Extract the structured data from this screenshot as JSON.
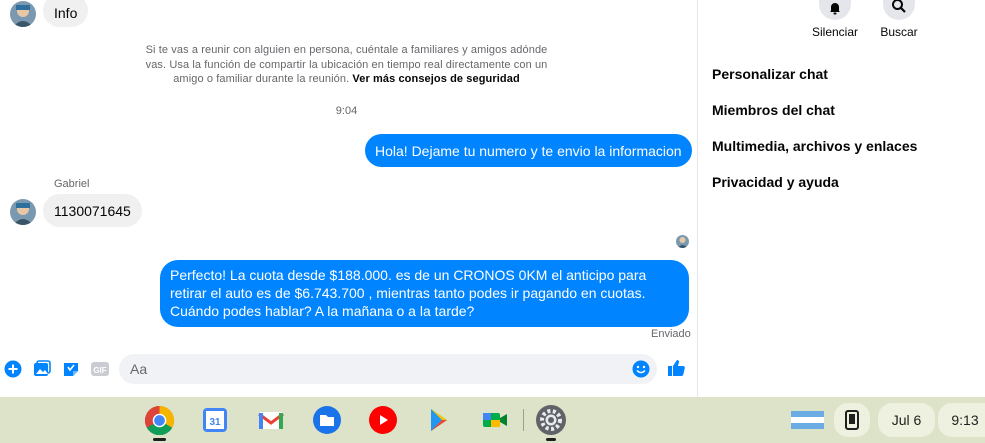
{
  "chat": {
    "top_message": "Info",
    "safety_notice": "Si te vas a reunir con alguien en persona, cuéntale a familiares y amigos adónde vas. Usa la función de compartir la ubicación en tiempo real directamente con un amigo o familiar durante la reunión.",
    "safety_link": "Ver más consejos de seguridad",
    "timestamp": "9:04",
    "sender_name": "Gabriel",
    "messages": [
      {
        "from": "me",
        "text": "Hola! Dejame tu numero y te envio la informacion"
      },
      {
        "from": "them",
        "text": "1130071645"
      },
      {
        "from": "me",
        "text": "Perfecto! La cuota desde $188.000. es de un CRONOS 0KM el anticipo para retirar el auto es de $6.743.700 , mientras tanto podes ir pagando en cuotas. Cuándo podes hablar? A la mañana o a la tarde?"
      }
    ],
    "delivery_status": "Enviado"
  },
  "composer": {
    "placeholder": "Aa",
    "icons": [
      "plus-circle-icon",
      "image-icon",
      "sticker-icon",
      "gif-icon",
      "emoji-icon",
      "like-icon"
    ]
  },
  "sidebar": {
    "actions": [
      {
        "label": "Silenciar",
        "icon": "bell-icon"
      },
      {
        "label": "Buscar",
        "icon": "search-icon"
      }
    ],
    "menu": [
      "Personalizar chat",
      "Miembros del chat",
      "Multimedia, archivos y enlaces",
      "Privacidad y ayuda"
    ]
  },
  "shelf": {
    "apps": [
      "chrome",
      "calendar",
      "gmail",
      "files",
      "youtube",
      "play-store",
      "meet",
      "settings"
    ],
    "calendar_day": "31",
    "date": "Jul 6",
    "time": "9:13"
  },
  "colors": {
    "accent": "#0084ff",
    "incoming_bubble": "#f0f0f0",
    "shelf": "#dde3c8"
  }
}
